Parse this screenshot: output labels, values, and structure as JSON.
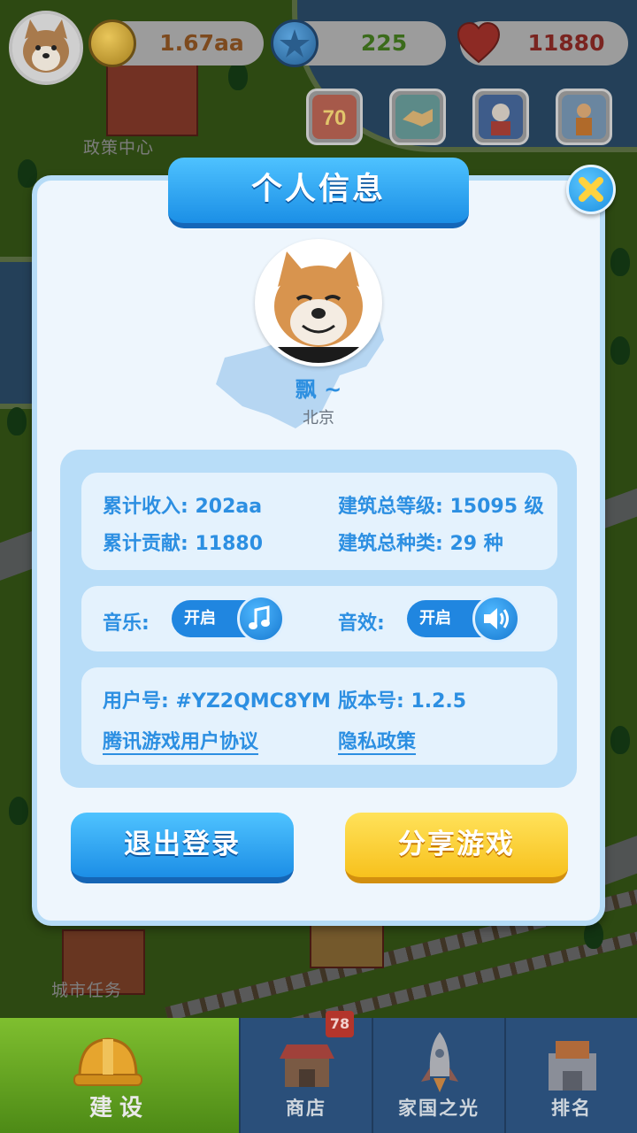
{
  "hud": {
    "coins": "1.67aa",
    "stars": "225",
    "hearts": "11880"
  },
  "scene": {
    "policy_center": "政策中心",
    "city_tasks": "城市任务"
  },
  "modal": {
    "title": "个人信息",
    "close_icon": "close-icon",
    "nickname": "飘 ~",
    "city": "北京",
    "stats": {
      "income": "累计收入: 202aa",
      "contribution": "累计贡献: 11880",
      "building_level": "建筑总等级: 15095 级",
      "building_types": "建筑总种类: 29 种"
    },
    "settings": {
      "music_label": "音乐:",
      "music_state": "开启",
      "sound_label": "音效:",
      "sound_state": "开启"
    },
    "account": {
      "user_id": "用户号: #YZ2QMC8YM",
      "version": "版本号: 1.2.5",
      "agreement_link": "腾讯游戏用户协议",
      "privacy_link": "隐私政策"
    },
    "buttons": {
      "logout": "退出登录",
      "share": "分享游戏"
    }
  },
  "nav": {
    "build": "建设",
    "shop": "商店",
    "shop_badge": "78",
    "homeland": "家国之光",
    "rank": "排名"
  },
  "colors": {
    "primary_blue": "#2c8fe2",
    "share_yellow": "#f7c11d",
    "heart_red": "#d8302a",
    "active_tab_green": "#7fbf2f"
  }
}
